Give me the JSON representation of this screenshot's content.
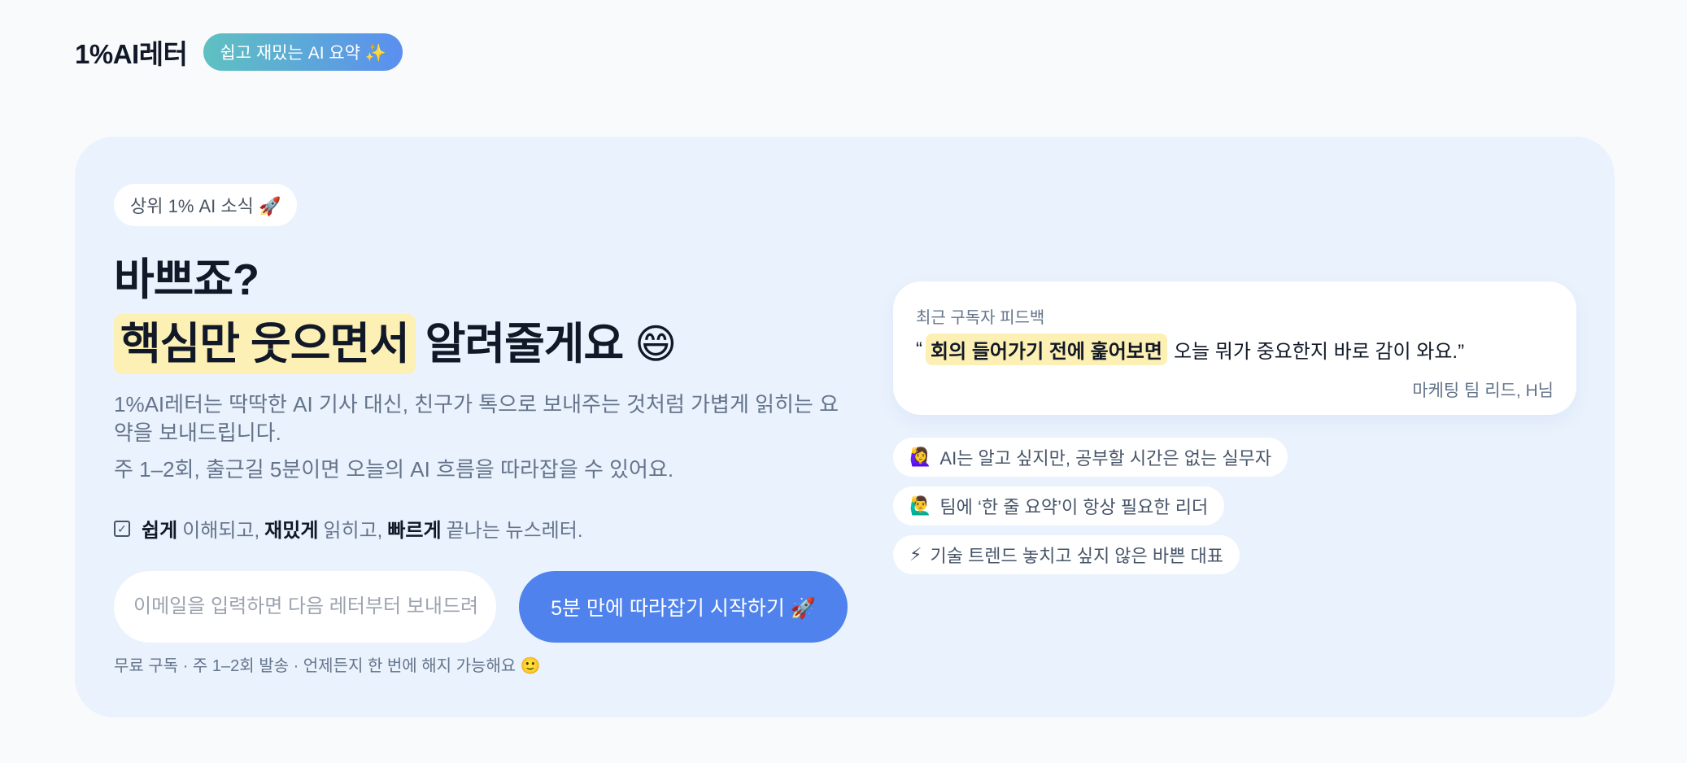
{
  "header": {
    "logo": "1%AI레터",
    "tagline": "쉽고 재밌는 AI 요약 ✨"
  },
  "hero": {
    "badge": "상위 1% AI 소식 🚀",
    "headline_line1": "바쁘죠?",
    "headline_highlight": "핵심만 웃으면서",
    "headline_rest": "알려줄게요",
    "headline_emoji": "😄",
    "description_1": "1%AI레터는 딱딱한 AI 기사 대신, 친구가 톡으로 보내주는 것처럼 가볍게 읽히는 요약을 보내드립니다.",
    "description_2": "주 1–2회, 출근길 5분이면 오늘의 AI 흐름을 따라잡을 수 있어요.",
    "check": {
      "bold_1": "쉽게",
      "text_1": "이해되고,",
      "bold_2": "재밌게",
      "text_2": "읽히고,",
      "bold_3": "빠르게",
      "text_3": "끝나는 뉴스레터."
    },
    "email_placeholder": "이메일을 입력하면 다음 레터부터 보내드려요",
    "email_value": "",
    "cta_label": "5분 만에 따라잡기 시작하기 🚀",
    "fineprint": "무료 구독 · 주 1–2회 발송 · 언제든지 한 번에 해지 가능해요 🙂"
  },
  "feedback": {
    "label": "최근 구독자 피드백",
    "open_quote": "“",
    "quote_highlight": "회의 들어가기 전에 훑어보면",
    "quote_rest": "오늘 뭐가 중요한지 바로 감이 와요.”",
    "author": "마케팅 팀 리드, H님"
  },
  "personas": [
    {
      "emoji": "🙋‍♀️",
      "text": "AI는 알고 싶지만, 공부할 시간은 없는 실무자"
    },
    {
      "emoji": "🙋‍♂️",
      "text": "팀에 ‘한 줄 요약’이 항상 필요한 리더"
    },
    {
      "emoji": "⚡",
      "text": "기술 트렌드 놓치고 싶지 않은 바쁜 대표"
    }
  ]
}
